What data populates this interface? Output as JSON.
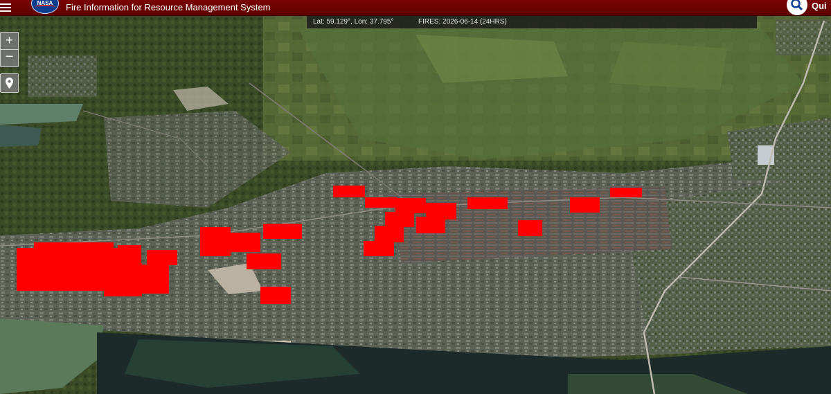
{
  "header": {
    "logo_text": "NASA",
    "title": "Fire Information for Resource Management System",
    "quick_search_label": "Qui"
  },
  "infobar": {
    "coordinates": "Lat: 59.129°, Lon: 37.795°",
    "fires_label": "FIRES: 2026-06-14 (24HRS)"
  },
  "controls": {
    "zoom_in": "+",
    "zoom_out": "−"
  },
  "icons": {
    "menu": "menu-icon",
    "logo": "nasa-logo",
    "search": "search-icon",
    "locate": "map-marker-icon"
  },
  "colors": {
    "header": "#6b0000",
    "fire_marker": "#ff0000",
    "river": "#1c2a2a"
  }
}
